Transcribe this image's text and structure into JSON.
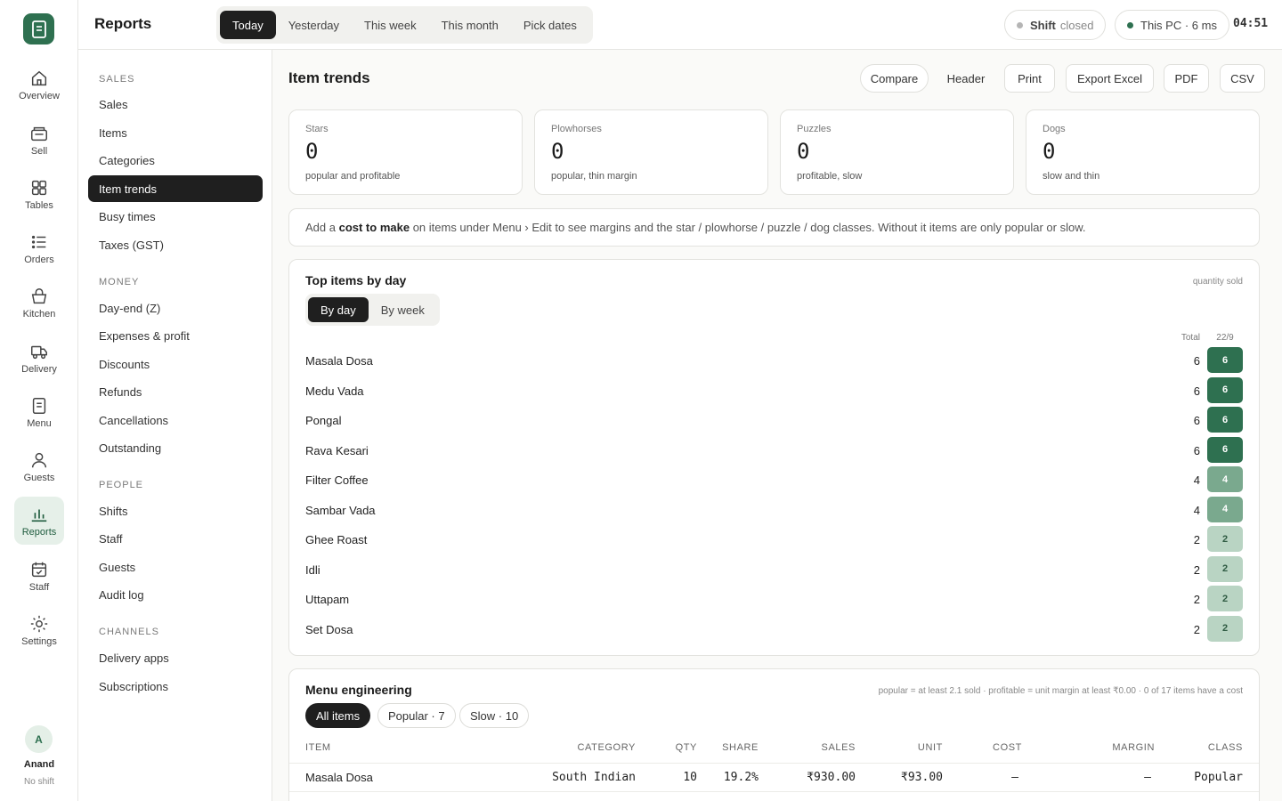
{
  "rail": {
    "items": [
      {
        "label": "Overview",
        "icon": "home-icon"
      },
      {
        "label": "Sell",
        "icon": "register-icon"
      },
      {
        "label": "Tables",
        "icon": "grid-icon"
      },
      {
        "label": "Orders",
        "icon": "list-icon"
      },
      {
        "label": "Kitchen",
        "icon": "basket-icon"
      },
      {
        "label": "Delivery",
        "icon": "delivery-icon"
      },
      {
        "label": "Menu",
        "icon": "menu-icon"
      },
      {
        "label": "Guests",
        "icon": "person-icon"
      },
      {
        "label": "Reports",
        "icon": "chart-icon"
      },
      {
        "label": "Staff",
        "icon": "calendar-icon"
      },
      {
        "label": "Settings",
        "icon": "gear-icon"
      }
    ],
    "active": "Reports",
    "user": {
      "initial": "A",
      "name": "Anand",
      "status": "No shift"
    }
  },
  "topbar": {
    "title": "Reports",
    "ranges": [
      "Today",
      "Yesterday",
      "This week",
      "This month",
      "Pick dates"
    ],
    "active_range": "Today",
    "shift": {
      "label": "Shift",
      "state": "closed"
    },
    "device": "This PC · 6 ms",
    "time": "04:51",
    "colors": {
      "shift_dot": "#b5b5b5",
      "device_dot": "#2e7050"
    }
  },
  "report_nav": {
    "sections": [
      {
        "title": "SALES",
        "items": [
          "Sales",
          "Items",
          "Categories",
          "Item trends",
          "Busy times",
          "Taxes (GST)"
        ]
      },
      {
        "title": "MONEY",
        "items": [
          "Day-end (Z)",
          "Expenses & profit",
          "Discounts",
          "Refunds",
          "Cancellations",
          "Outstanding"
        ]
      },
      {
        "title": "PEOPLE",
        "items": [
          "Shifts",
          "Staff",
          "Guests",
          "Audit log"
        ]
      },
      {
        "title": "CHANNELS",
        "items": [
          "Delivery apps",
          "Subscriptions"
        ]
      }
    ],
    "active": "Item trends"
  },
  "main": {
    "title": "Item trends",
    "actions": [
      "Compare",
      "Header",
      "Print",
      "Export Excel",
      "PDF",
      "CSV"
    ],
    "stats": [
      {
        "label": "Stars",
        "value": "0",
        "desc": "popular and profitable"
      },
      {
        "label": "Plowhorses",
        "value": "0",
        "desc": "popular, thin margin"
      },
      {
        "label": "Puzzles",
        "value": "0",
        "desc": "profitable, slow"
      },
      {
        "label": "Dogs",
        "value": "0",
        "desc": "slow and thin"
      }
    ],
    "note": {
      "pre": "Add a ",
      "bold": "cost to make",
      "post": " on items under Menu › Edit to see margins and the star / plowhorse / puzzle / dog classes. Without it items are only popular or slow."
    },
    "top_items": {
      "title": "Top items by day",
      "hint": "quantity sold",
      "tabs": [
        "By day",
        "By week"
      ],
      "active_tab": "By day",
      "col_total": "Total",
      "col_day": "22/9",
      "rows": [
        {
          "name": "Masala Dosa",
          "total": "6",
          "day": "6",
          "level": 1.0
        },
        {
          "name": "Medu Vada",
          "total": "6",
          "day": "6",
          "level": 1.0
        },
        {
          "name": "Pongal",
          "total": "6",
          "day": "6",
          "level": 1.0
        },
        {
          "name": "Rava Kesari",
          "total": "6",
          "day": "6",
          "level": 1.0
        },
        {
          "name": "Filter Coffee",
          "total": "4",
          "day": "4",
          "level": 0.67
        },
        {
          "name": "Sambar Vada",
          "total": "4",
          "day": "4",
          "level": 0.67
        },
        {
          "name": "Ghee Roast",
          "total": "2",
          "day": "2",
          "level": 0.33
        },
        {
          "name": "Idli",
          "total": "2",
          "day": "2",
          "level": 0.33
        },
        {
          "name": "Uttapam",
          "total": "2",
          "day": "2",
          "level": 0.33
        },
        {
          "name": "Set Dosa",
          "total": "2",
          "day": "2",
          "level": 0.33
        }
      ],
      "colors": {
        "high": "#2e7050",
        "mid": "#7aa98e",
        "low": "#b9d4c3"
      }
    },
    "menu_engineering": {
      "title": "Menu engineering",
      "hint": "popular = at least 2.1 sold · profitable = unit margin at least ₹0.00 · 0 of 17 items have a cost",
      "filters": [
        "All items",
        "Popular · 7",
        "Slow · 10"
      ],
      "active_filter": "All items",
      "columns": [
        "ITEM",
        "CATEGORY",
        "QTY",
        "SHARE",
        "SALES",
        "UNIT",
        "COST",
        "MARGIN",
        "CLASS"
      ],
      "rows": [
        {
          "item": "Masala Dosa",
          "category": "South Indian",
          "qty": "10",
          "share": "19.2%",
          "sales": "₹930.00",
          "unit": "₹93.00",
          "cost": "—",
          "margin": "—",
          "class": "Popular"
        }
      ]
    }
  }
}
